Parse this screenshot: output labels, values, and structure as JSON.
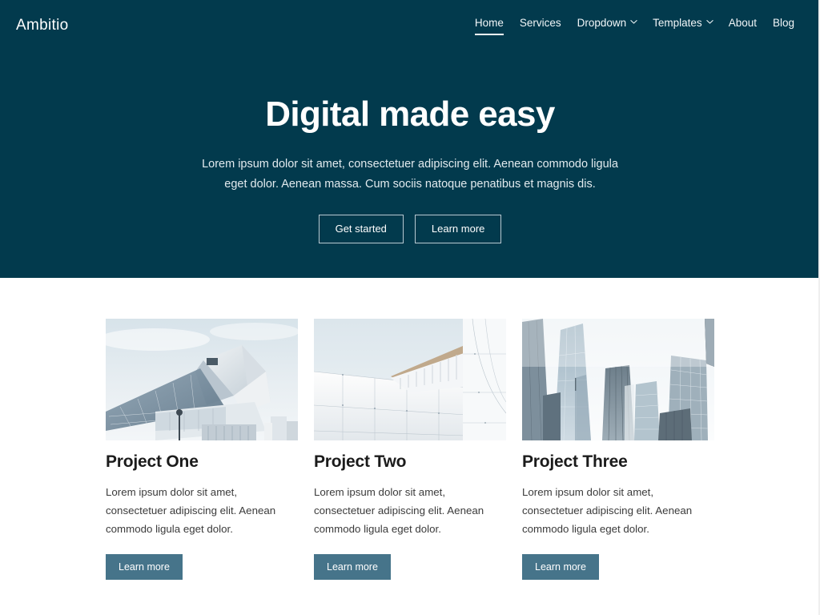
{
  "brand": {
    "name": "Ambitio"
  },
  "nav": {
    "items": [
      {
        "label": "Home",
        "active": true,
        "caret": false,
        "icon": ""
      },
      {
        "label": "Services",
        "active": false,
        "caret": false,
        "icon": ""
      },
      {
        "label": "Dropdown",
        "active": false,
        "caret": true,
        "icon": "chevron-down-icon"
      },
      {
        "label": "Templates",
        "active": false,
        "caret": true,
        "icon": "chevron-down-icon"
      },
      {
        "label": "About",
        "active": false,
        "caret": false,
        "icon": ""
      },
      {
        "label": "Blog",
        "active": false,
        "caret": false,
        "icon": ""
      }
    ]
  },
  "hero": {
    "title": "Digital made easy",
    "subtitle": "Lorem ipsum dolor sit amet, consectetuer adipiscing elit. Aenean commodo ligula eget dolor. Aenean massa. Cum sociis natoque penatibus et magnis dis.",
    "primary_button": "Get started",
    "secondary_button": "Learn more",
    "background_color": "#023a4d"
  },
  "cards": [
    {
      "title": "Project One",
      "text": "Lorem ipsum dolor sit amet, consectetuer adipiscing elit. Aenean commodo ligula eget dolor.",
      "button": "Learn more",
      "image_alt": "glass-pyramid-building-photo"
    },
    {
      "title": "Project Two",
      "text": "Lorem ipsum dolor sit amet, consectetuer adipiscing elit. Aenean commodo ligula eget dolor.",
      "button": "Learn more",
      "image_alt": "white-minimal-architecture-photo"
    },
    {
      "title": "Project Three",
      "text": "Lorem ipsum dolor sit amet, consectetuer adipiscing elit. Aenean commodo ligula eget dolor.",
      "button": "Learn more",
      "image_alt": "skyscrapers-upward-view-photo"
    }
  ],
  "theme": {
    "accent": "#46748a",
    "hero_bg": "#023a4d",
    "page_bg": "#ffffff",
    "heading_color": "#1b1b1b"
  }
}
